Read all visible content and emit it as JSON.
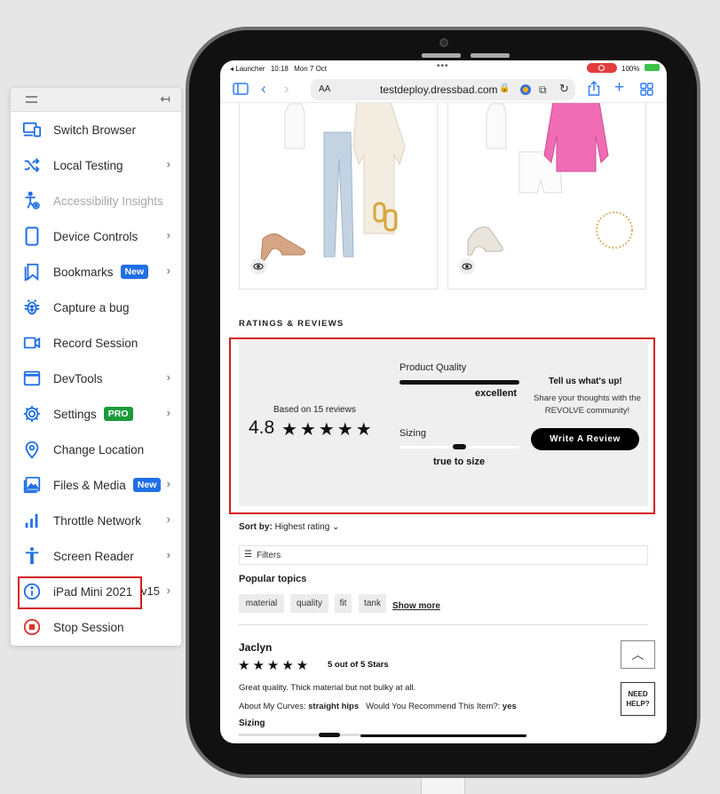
{
  "tool_panel": {
    "items": [
      {
        "label": "Switch Browser",
        "icon": "switch-browser-icon",
        "chevron": false
      },
      {
        "label": "Local Testing",
        "icon": "shuffle-icon",
        "chevron": true
      },
      {
        "label": "Accessibility Insights",
        "icon": "accessibility-icon",
        "chevron": false,
        "disabled": true
      },
      {
        "label": "Device Controls",
        "icon": "phone-icon",
        "chevron": true
      },
      {
        "label": "Bookmarks",
        "icon": "bookmark-icon",
        "chevron": true,
        "badge": "New"
      },
      {
        "label": "Capture a bug",
        "icon": "bug-icon",
        "chevron": false
      },
      {
        "label": "Record Session",
        "icon": "video-camera-icon",
        "chevron": false
      },
      {
        "label": "DevTools",
        "icon": "window-icon",
        "chevron": true
      },
      {
        "label": "Settings",
        "icon": "gear-icon",
        "chevron": true,
        "badge": "PRO"
      },
      {
        "label": "Change Location",
        "icon": "location-pin-icon",
        "chevron": false
      },
      {
        "label": "Files & Media",
        "icon": "image-icon",
        "chevron": true,
        "badge": "New"
      },
      {
        "label": "Throttle Network",
        "icon": "signal-bars-icon",
        "chevron": true
      },
      {
        "label": "Screen Reader",
        "icon": "person-icon",
        "chevron": true
      },
      {
        "label": "iPad Mini 2021",
        "icon": "info-icon",
        "chevron": true,
        "version": "v15"
      },
      {
        "label": "Stop Session",
        "icon": "stop-icon",
        "chevron": false
      }
    ]
  },
  "status_bar": {
    "launcher": "◂ Launcher",
    "time": "10:18",
    "date": "Mon 7 Oct",
    "battery": "100%"
  },
  "safari": {
    "aa": "AA",
    "url": "testdeploy.dressbad.com"
  },
  "ratings": {
    "section_title": "RATINGS & REVIEWS",
    "based_on": "Based on 15 reviews",
    "score": "4.8",
    "stars": "★★★★★",
    "product_quality_label": "Product Quality",
    "product_quality_value": "excellent",
    "product_quality_level": 1.0,
    "sizing_label": "Sizing",
    "sizing_value": "true to size",
    "sizing_level": 0.5,
    "tell_us": "Tell us what's up!",
    "share_text": "Share your thoughts with the REVOLVE community!",
    "write_button": "Write A Review"
  },
  "reviews_list": {
    "sort_label": "Sort by:",
    "sort_value": "Highest rating",
    "filters": "Filters",
    "popular_topics": "Popular topics",
    "topics": [
      "material",
      "quality",
      "fit",
      "tank"
    ],
    "show_more": "Show more",
    "review": {
      "name": "Jaclyn",
      "stars": "★★★★★",
      "rating_text": "5 out of 5 Stars",
      "text": "Great quality. Thick material but not bulky at all.",
      "curves_label": "About My Curves:",
      "curves_value": "straight hips",
      "recommend_label": "Would You Recommend This Item?:",
      "recommend_value": "yes",
      "sizing": "Sizing"
    },
    "help": "NEED HELP?"
  },
  "colors": {
    "accent_blue": "#1f6fe5",
    "pro_green": "#1a9a3c",
    "highlight_red": "#d41c1c"
  }
}
